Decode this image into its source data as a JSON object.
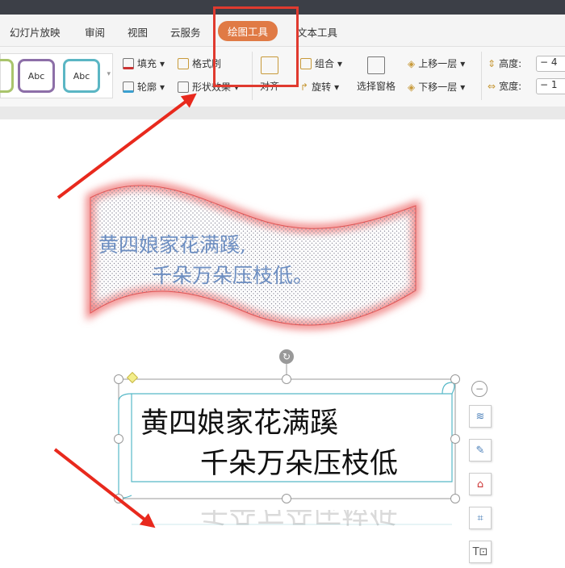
{
  "tabs": [
    "幻灯片放映",
    "审阅",
    "视图",
    "云服务",
    "绘图工具",
    "文本工具"
  ],
  "active_tab": "绘图工具",
  "ribbon": {
    "style_sample": "Abc",
    "fill": "填充",
    "format_painter": "格式刷",
    "outline": "轮廓",
    "shape_effects": "形状效果",
    "align": "对齐",
    "group": "组合",
    "rotate": "旋转",
    "selection_pane": "选择窗格",
    "bring_forward": "上移一层",
    "send_backward": "下移一层",
    "height_label": "高度:",
    "width_label": "宽度:",
    "height_value": "4",
    "width_value": "1",
    "minus": "−"
  },
  "wave_shape": {
    "line1": "黄四娘家花满蹊,",
    "line2": "千朵万朵压枝低。"
  },
  "scroll_shape": {
    "line1": "黄四娘家花满蹊",
    "line2": "千朵万朵压枝低"
  },
  "colors": {
    "accent": "#e07a45",
    "highlight": "#e03a2f",
    "arrow": "#e8291d",
    "text_blue": "#6e8fc2"
  }
}
